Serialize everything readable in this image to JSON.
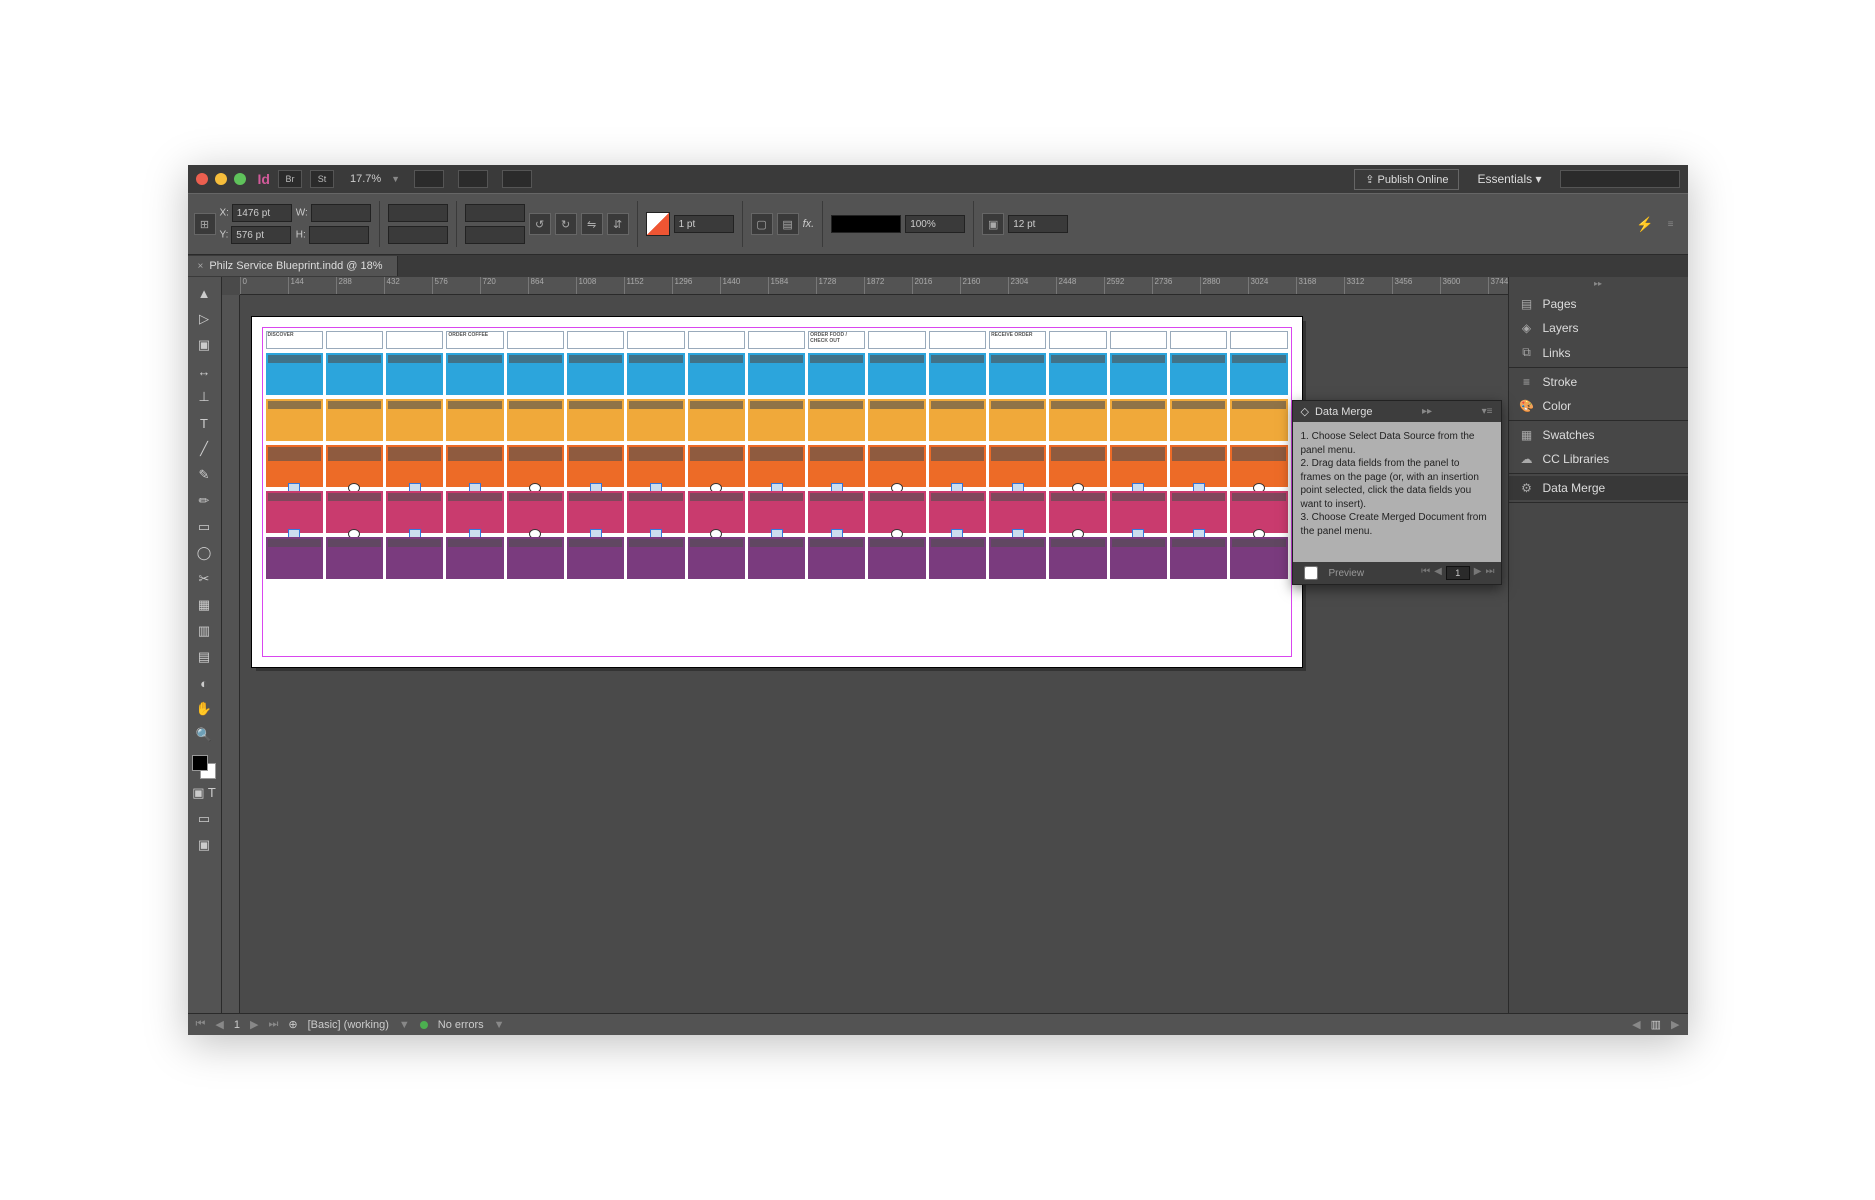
{
  "app": {
    "zoom_label": "17.7%",
    "publish_label": "Publish Online",
    "workspace_label": "Essentials"
  },
  "bridge_label": "Br",
  "stock_label": "St",
  "control": {
    "x_label": "X:",
    "x_value": "1476 pt",
    "y_label": "Y:",
    "y_value": "576 pt",
    "w_label": "W:",
    "h_label": "H:",
    "stroke_value": "1 pt",
    "opacity_value": "100%",
    "gap_value": "12 pt",
    "fx_label": "fx."
  },
  "doc": {
    "tab_title": "Philz Service Blueprint.indd @ 18%"
  },
  "ruler": [
    "0",
    "144",
    "288",
    "432",
    "576",
    "720",
    "864",
    "1008",
    "1152",
    "1296",
    "1440",
    "1584",
    "1728",
    "1872",
    "2016",
    "2160",
    "2304",
    "2448",
    "2592",
    "2736",
    "2880",
    "3024",
    "3168",
    "3312",
    "3456",
    "3600",
    "3744"
  ],
  "tools": [
    "▲",
    "▶",
    "▣",
    "↔",
    "⊥",
    "T",
    "╱",
    "✎",
    "✏",
    "▭",
    "◯",
    "✂",
    "▦",
    "▥",
    "▤",
    "◐",
    "✋",
    "🔍"
  ],
  "dock": {
    "pages": "Pages",
    "layers": "Layers",
    "links": "Links",
    "stroke": "Stroke",
    "color": "Color",
    "swatches": "Swatches",
    "cclib": "CC Libraries",
    "datamerge": "Data Merge"
  },
  "blueprint": {
    "headers": [
      "DISCOVER",
      "",
      "",
      "ORDER COFFEE",
      "",
      "",
      "",
      "",
      "",
      "ORDER FOOD / CHECK OUT",
      "",
      "",
      "RECEIVE ORDER",
      "",
      "",
      "",
      ""
    ]
  },
  "datamerge_panel": {
    "title": "Data Merge",
    "body_1": "1. Choose Select Data Source from the panel menu.",
    "body_2": "2. Drag data fields from the panel to frames on the page (or, with an insertion point selected, click the data fields you want to insert).",
    "body_3": "3. Choose Create Merged Document from the panel menu.",
    "preview_label": "Preview",
    "page_value": "1"
  },
  "status": {
    "page": "1",
    "style": "[Basic] (working)",
    "errors": "No errors"
  }
}
